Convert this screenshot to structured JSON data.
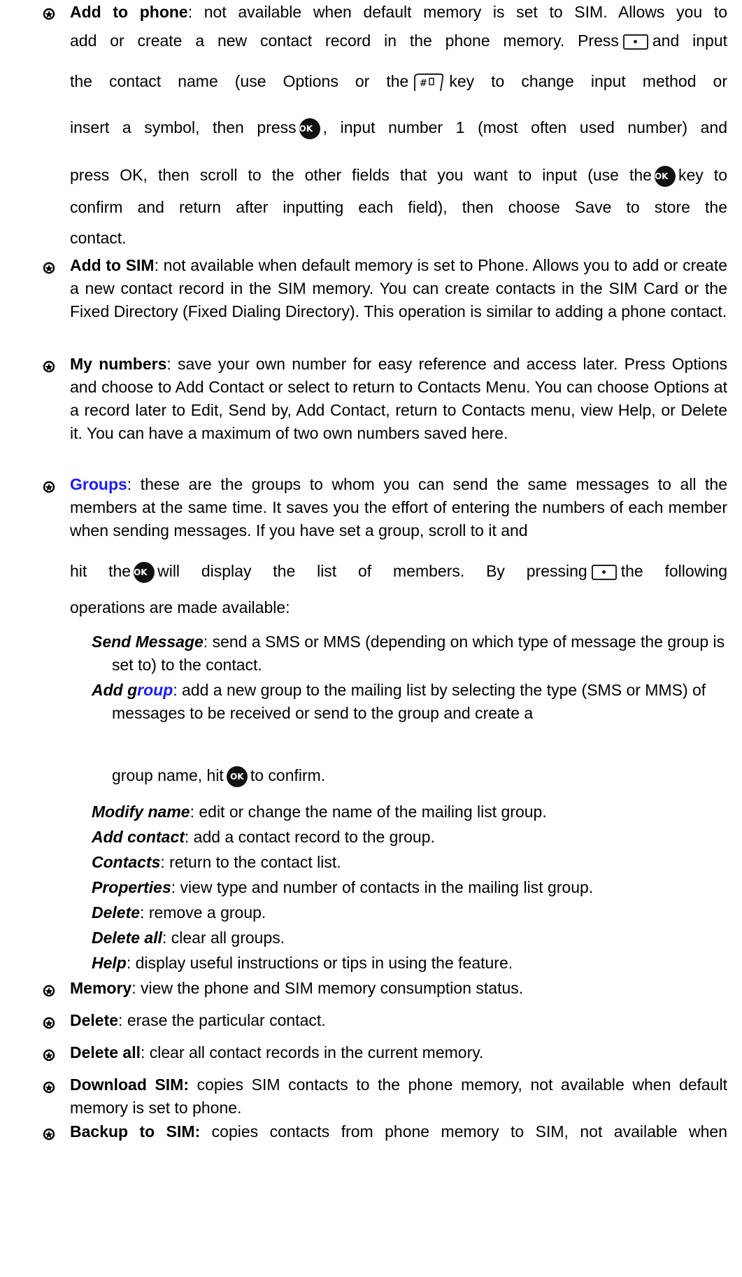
{
  "icons": {
    "menu_key": "menu-softkey-icon",
    "hash_key": "hash-key-icon",
    "ok_key": "ok-key-icon",
    "ok_label": "OK",
    "hash_label": "#а",
    "bullet": "bullet-icon"
  },
  "colors": {
    "link": "#1a1aff",
    "text": "#000000"
  },
  "items": {
    "add_phone": {
      "term": "Add to phone",
      "l1": ": not available when default memory is set to SIM. Allows you to",
      "l2a": "add or create a new contact record in the phone memory. Press",
      "l2b": "and input",
      "l3a": "the contact name (use Options or the",
      "l3b": "key to change input method or",
      "l4a": "insert a symbol, then press",
      "l4b": ", input number 1 (most often used number) and",
      "l5a": "press OK, then scroll to the other fields that you want to input (use the",
      "l5b": "key to",
      "l6": "confirm and return after inputting each field), then choose Save to store the",
      "l7": "contact."
    },
    "add_sim": {
      "term": "Add to SIM",
      "text": ": not available when default memory is set to Phone. Allows you to add or create a new contact record in the SIM memory. You can create contacts in the SIM Card or the Fixed Directory (Fixed Dialing Directory). This operation is similar to adding a phone contact."
    },
    "my_numbers": {
      "term": "My numbers",
      "text": ": save your own number for easy reference and access later. Press Options and choose to Add Contact or select to return to Contacts Menu. You can choose Options at a record later to Edit, Send by, Add Contact, return to Contacts menu, view Help, or Delete it. You can have a maximum of two own numbers saved here."
    },
    "groups": {
      "term": "Groups",
      "text": ": these are the groups to whom you can send the same messages to all the members at the same time. It saves you the effort of entering the numbers of each member when sending messages. If you have set a group, scroll to it and",
      "l4a": "hit the",
      "l4b": "will display the list of members. By pressing",
      "l4c": "the following",
      "l5": "operations are made available:",
      "sub": {
        "send_msg_term": "Send Message",
        "send_msg_text": ": send a SMS or MMS (depending on which type of message the group is set to) to the contact.",
        "add_group_term_a": "Add g",
        "add_group_term_b": "roup",
        "add_group_text": ": add a new group to the mailing list by selecting the type (SMS or MMS) of messages to be received or send to the group and create a",
        "add_group_l3a": "group name, hit",
        "add_group_l3b": "to confirm.",
        "modify_term": "Modify name",
        "modify_text": ": edit or change the name of the mailing list group.",
        "add_contact_term": "Add contact",
        "add_contact_text": ": add a contact record to the group.",
        "contacts_term": "Contacts",
        "contacts_text": ": return to the contact list.",
        "properties_term": "Properties",
        "properties_text": ": view type and number of contacts in the mailing list group.",
        "delete_term": "Delete",
        "delete_text": ": remove a group.",
        "delete_all_term": "Delete all",
        "delete_all_text": ": clear all groups.",
        "help_term": "Help",
        "help_text": ": display useful instructions or tips in using the feature."
      }
    },
    "memory": {
      "term": "Memory",
      "text": ": view the phone and SIM memory consumption status."
    },
    "delete": {
      "term": "Delete",
      "text": ": erase the particular contact."
    },
    "delete_all": {
      "term": "Delete all",
      "text": ": clear all contact records in the current memory."
    },
    "download_sim": {
      "term": "Download SIM:",
      "text": " copies SIM contacts to the phone memory, not available when default memory is set to phone."
    },
    "backup_sim": {
      "term": "Backup to SIM:",
      "text": " copies contacts from phone memory to SIM, not available when"
    }
  }
}
